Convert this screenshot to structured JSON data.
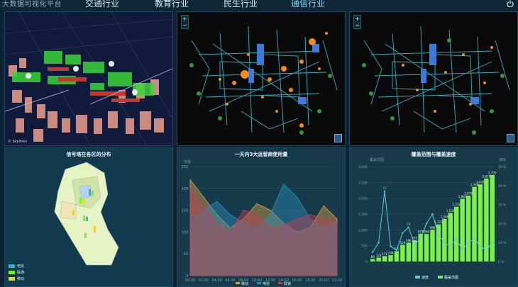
{
  "header": {
    "brand": "大数据可视化平台",
    "nav": [
      "交通行业",
      "教育行业",
      "民生行业",
      "通信行业"
    ],
    "active_index": 3
  },
  "panels": {
    "map3d": {
      "attribution": "© Skylines"
    },
    "tower_map": {
      "title": "信号塔在各区的分布",
      "legend": [
        {
          "label": "电信",
          "color": "#1fb8d4"
        },
        {
          "label": "联通",
          "color": "#7cf02b"
        },
        {
          "label": "移动",
          "color": "#f0d424"
        }
      ]
    }
  },
  "chart_data": [
    {
      "type": "area",
      "title": "一天内3大运营商使用量",
      "ylabel": "流量",
      "ylim": [
        0,
        250
      ],
      "yticks": [
        0,
        50,
        100,
        150,
        200,
        250
      ],
      "x": [
        "00:00",
        "02:00",
        "04:00",
        "06:00",
        "08:00",
        "10:00",
        "12:00",
        "14:00",
        "16:00",
        "18:00",
        "20:00",
        "22:00"
      ],
      "series": [
        {
          "name": "移动",
          "color": "#d7a14a",
          "values": [
            220,
            180,
            140,
            110,
            130,
            165,
            150,
            120,
            100,
            110,
            160,
            130
          ]
        },
        {
          "name": "电信",
          "color": "#2a8fb8",
          "values": [
            130,
            150,
            170,
            140,
            120,
            110,
            140,
            210,
            180,
            130,
            110,
            120
          ]
        },
        {
          "name": "联通",
          "color": "#c0415a",
          "values": [
            200,
            160,
            120,
            100,
            150,
            140,
            110,
            115,
            130,
            140,
            130,
            120
          ]
        }
      ]
    },
    {
      "type": "bar",
      "title": "覆盖范围与覆盖速度",
      "ylabel_left": "覆盖范围",
      "ylabel_right": "速度",
      "ylim_left": [
        0,
        3000
      ],
      "yticks_left": [
        "0",
        "500",
        "1,000",
        "1,500",
        "2,000",
        "2,500",
        "3,000"
      ],
      "ylim_right": [
        0,
        50
      ],
      "yticks_right": [
        "0 %",
        "10 %",
        "20 %",
        "30 %",
        "40 %",
        "50 %"
      ],
      "bar_labels": [
        "80",
        "123",
        "171",
        "198",
        "325",
        "529",
        "596",
        "672",
        "877",
        "868",
        "998",
        "1,173",
        "1,346",
        "1,531",
        "1,732",
        "1,981",
        "2,079",
        "2,354",
        "2,435",
        "2,619",
        "2,735"
      ],
      "bar_values": [
        80,
        123,
        171,
        198,
        325,
        529,
        596,
        672,
        877,
        868,
        998,
        1173,
        1346,
        1531,
        1732,
        1981,
        2079,
        2354,
        2435,
        2619,
        2735
      ],
      "line_values": [
        5,
        10,
        37,
        8,
        6,
        15,
        18,
        9,
        12,
        20,
        25,
        14,
        10,
        8,
        12,
        6,
        10,
        12,
        8,
        6,
        10
      ],
      "line_point_labels": [
        {
          "index": 2,
          "label": "37"
        },
        {
          "index": 6,
          "label": "29"
        }
      ],
      "legend": [
        {
          "label": "速度",
          "color": "#56d0e0"
        },
        {
          "label": "覆盖范围",
          "color": "#7cf04a"
        }
      ]
    }
  ]
}
